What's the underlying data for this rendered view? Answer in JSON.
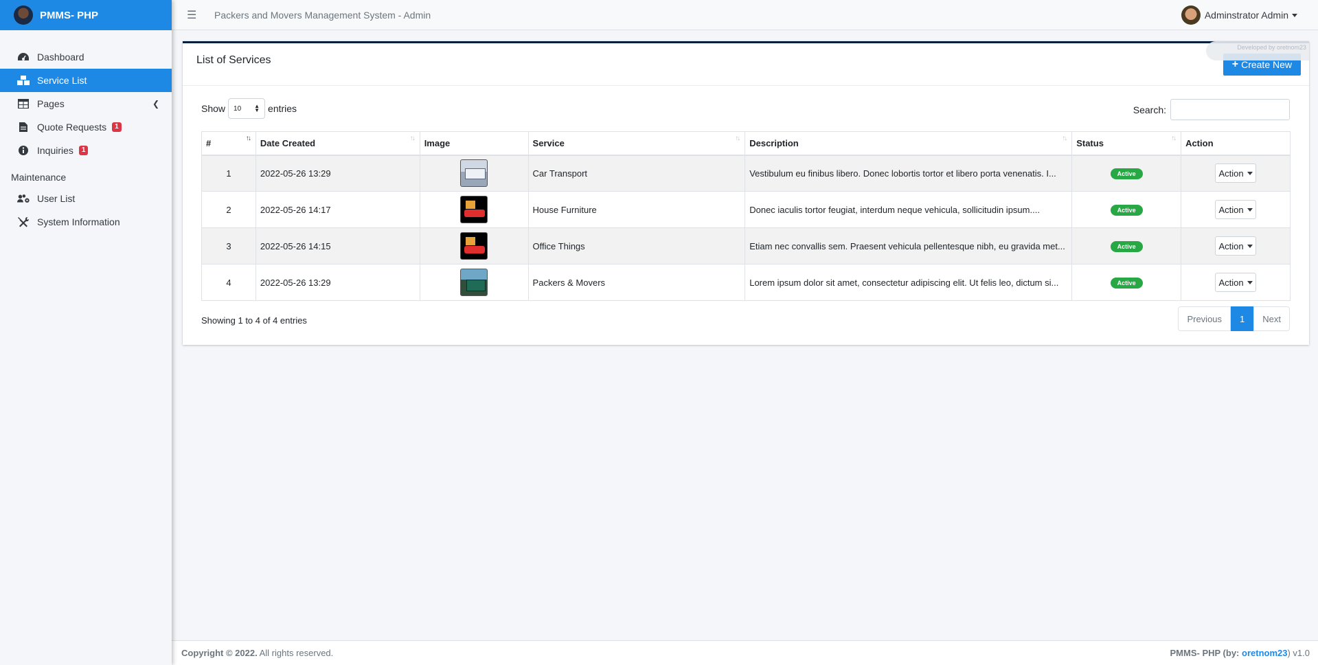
{
  "brand": {
    "name": "PMMS- PHP"
  },
  "sidebar": {
    "items": [
      {
        "label": "Dashboard"
      },
      {
        "label": "Service List"
      },
      {
        "label": "Pages"
      },
      {
        "label": "Quote Requests",
        "badge": "1"
      },
      {
        "label": "Inquiries",
        "badge": "1"
      }
    ],
    "section_header": "Maintenance",
    "maintenance": [
      {
        "label": "User List"
      },
      {
        "label": "System Information"
      }
    ]
  },
  "topbar": {
    "title": "Packers and Movers Management System - Admin",
    "user": "Adminstrator Admin"
  },
  "card": {
    "title": "List of Services",
    "create_label": "Create New",
    "dev_note": "Developed by oretnom23"
  },
  "table_controls": {
    "show_label": "Show",
    "entries_value": "10",
    "entries_label": "entries",
    "search_label": "Search:"
  },
  "table": {
    "headers": [
      "#",
      "Date Created",
      "Image",
      "Service",
      "Description",
      "Status",
      "Action"
    ],
    "rows": [
      {
        "num": "1",
        "date": "2022-05-26 13:29",
        "image": "truck-image",
        "service": "Car Transport",
        "description": "Vestibulum eu finibus libero. Donec lobortis tortor et libero porta venenatis. I...",
        "status": "Active",
        "action": "Action"
      },
      {
        "num": "2",
        "date": "2022-05-26 14:17",
        "image": "van-image",
        "service": "House Furniture",
        "description": "Donec iaculis tortor feugiat, interdum neque vehicula, sollicitudin ipsum....",
        "status": "Active",
        "action": "Action"
      },
      {
        "num": "3",
        "date": "2022-05-26 14:15",
        "image": "van-image",
        "service": "Office Things",
        "description": "Etiam nec convallis sem. Praesent vehicula pellentesque nibh, eu gravida met...",
        "status": "Active",
        "action": "Action"
      },
      {
        "num": "4",
        "date": "2022-05-26 13:29",
        "image": "cargo-truck-image",
        "service": "Packers & Movers",
        "description": "Lorem ipsum dolor sit amet, consectetur adipiscing elit. Ut felis leo, dictum si...",
        "status": "Active",
        "action": "Action"
      }
    ]
  },
  "table_footer": {
    "info": "Showing 1 to 4 of 4 entries",
    "previous": "Previous",
    "current_page": "1",
    "next": "Next"
  },
  "footer": {
    "copyright": "Copyright © 2022.",
    "rights": "All rights reserved.",
    "app_prefix": "PMMS- PHP (by:",
    "author": "oretnom23",
    "version_suffix": ") v1.0"
  },
  "colors": {
    "primary": "#1e88e5",
    "success": "#28a745",
    "danger": "#dc3545",
    "card_top": "#001f3f"
  }
}
